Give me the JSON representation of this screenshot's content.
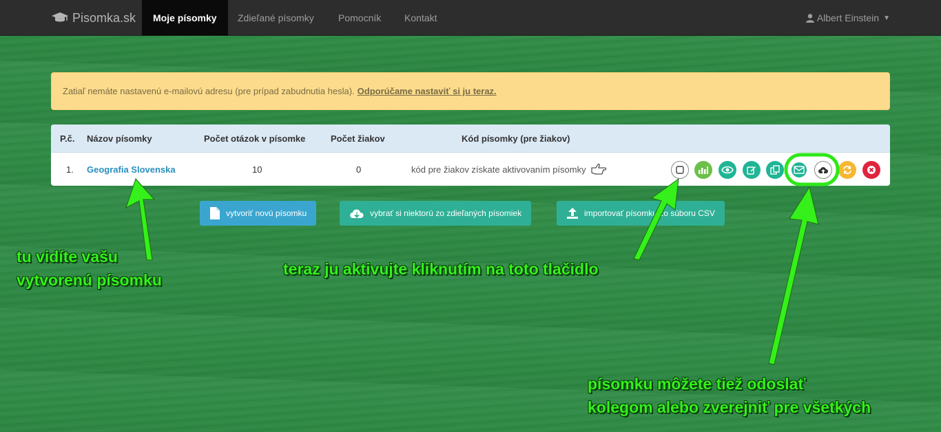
{
  "navbar": {
    "brand": "Pisomka.sk",
    "items": [
      {
        "label": "Moje písomky"
      },
      {
        "label": "Zdieľané písomky"
      },
      {
        "label": "Pomocník"
      },
      {
        "label": "Kontakt"
      }
    ],
    "user": "Albert Einstein"
  },
  "alert": {
    "text": "Zatiaľ nemáte nastavenú e-mailovú adresu (pre prípad zabudnutia hesla).",
    "link": "Odporúčame nastaviť si ju teraz."
  },
  "table": {
    "headers": {
      "num": "P.č.",
      "name": "Názov písomky",
      "questions": "Počet otázok v písomke",
      "students": "Počet žiakov",
      "code": "Kód písomky (pre žiakov)"
    },
    "rows": [
      {
        "num": "1.",
        "name": "Geografia Slovenska",
        "questions": "10",
        "students": "0",
        "code": "kód pre žiakov získate aktivovaním písomky"
      }
    ]
  },
  "buttons": {
    "create": "vytvoriť novú písomku",
    "choose": "vybrať si niektorú zo zdieľaných písomiek",
    "import": "importovať písomku zo súboru CSV"
  },
  "annotations": {
    "left_line1": "tu vidíte vašu",
    "left_line2": "vytvorenú písomku",
    "center": "teraz ju aktivujte kliknutím na toto tlačidlo",
    "right_line1": "písomku môžete tiež odoslať",
    "right_line2": "kolegom alebo zverejniť pre všetkých"
  },
  "colors": {
    "background": "#2f8a45",
    "navbar": "#2d2d2d",
    "alert": "#fcdc8c",
    "annotation": "#35f01a",
    "action_green": "#6cc04a",
    "action_teal": "#1fb595",
    "action_orange": "#f7b730",
    "action_red": "#e0243e"
  },
  "icons": {
    "brand": "graduation-cap-icon",
    "user": "user-icon",
    "pointer": "hand-pointing-right-icon",
    "actions": [
      "activate-checkbox-icon",
      "statistics-icon",
      "preview-eye-icon",
      "edit-icon",
      "copy-icon",
      "send-email-icon",
      "publish-cloud-upload-icon",
      "refresh-icon",
      "delete-icon"
    ]
  }
}
